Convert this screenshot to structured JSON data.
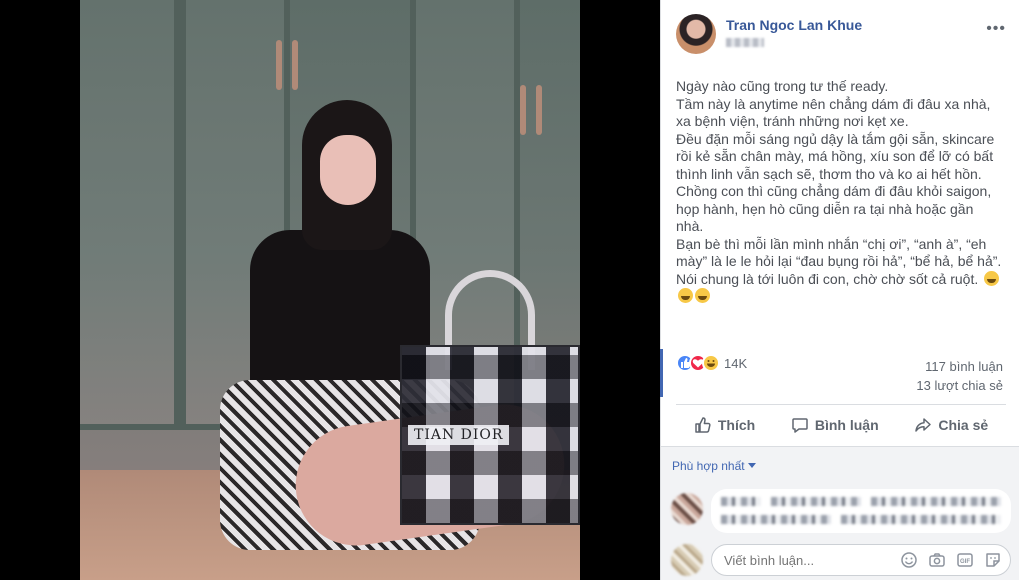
{
  "photo": {
    "bag_print": "TIAN DIOR"
  },
  "post": {
    "author": "Tran Ngoc Lan Khue",
    "more_icon": "more-horizontal-icon",
    "text": "Ngày nào cũng trong tư thế ready.\nTầm này là anytime nên chẳng dám đi đâu xa nhà,\nxa bệnh viện, tránh những nơi kẹt xe.\nĐều đặn mỗi sáng ngủ dậy là tắm gội sẵn, skincare\nrồi kẻ sẵn chân mày, má hồng, xíu son để lỡ có bất\nthình linh vẫn sạch sẽ, thơm tho và ko ai hết hồn.\nChồng con thì cũng chẳng dám đi đâu khỏi saigon,\nhọp hành, hẹn hò cũng diễn ra tại nhà hoặc gần\nnhà.\nBạn bè thì mỗi lần mình nhắn “chị ơi”, “anh à”, “eh\nmày” là le le hỏi lại “đau bụng rồi hả”, “bể hả, bể hả”.\nNói chung là tới luôn đi con, chờ chờ sốt cả ruột."
  },
  "reactions": {
    "types": [
      "like",
      "love",
      "haha"
    ],
    "count": "14K",
    "comments": "117 bình luận",
    "shares": "13 lượt chia sẻ"
  },
  "actions": {
    "like_label": "Thích",
    "comment_label": "Bình luận",
    "share_label": "Chia sẻ"
  },
  "comments": {
    "sort_label": "Phù hợp nhất",
    "composer_placeholder": "Viết bình luận...",
    "composer_icons": [
      "emoji-icon",
      "camera-icon",
      "gif-icon",
      "sticker-icon"
    ]
  },
  "colors": {
    "accent": "#4267b2",
    "link": "#385898",
    "text": "#4b4f56",
    "muted": "#606770"
  }
}
